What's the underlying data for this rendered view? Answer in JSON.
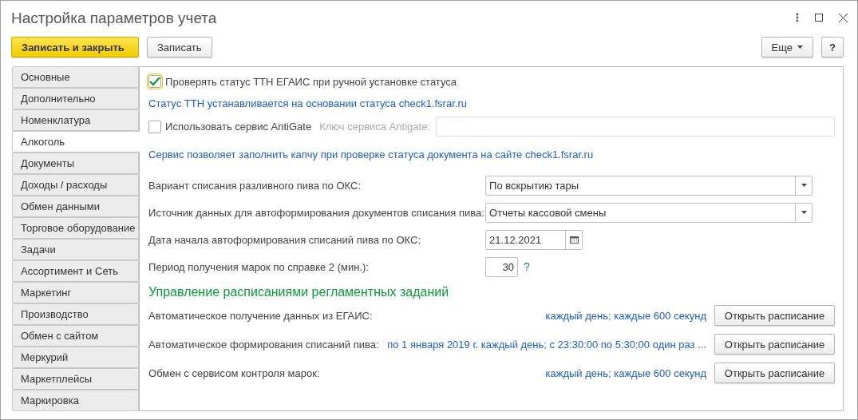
{
  "window": {
    "title": "Настройка параметров учета"
  },
  "toolbar": {
    "buttons": [
      {
        "label": "Записать и закрыть",
        "kind": "primary"
      },
      {
        "label": "Записать",
        "kind": "normal"
      }
    ],
    "more": "Еще",
    "help": "?"
  },
  "sidebar": {
    "items": [
      {
        "label": "Основные",
        "selected": false
      },
      {
        "label": "Дополнительно",
        "selected": false
      },
      {
        "label": "Номенклатура",
        "selected": false
      },
      {
        "label": "Алкоголь",
        "selected": true
      },
      {
        "label": "Документы",
        "selected": false
      },
      {
        "label": "Доходы / расходы",
        "selected": false
      },
      {
        "label": "Обмен данными",
        "selected": false
      },
      {
        "label": "Торговое оборудование",
        "selected": false
      },
      {
        "label": "Задачи",
        "selected": false
      },
      {
        "label": "Ассортимент и Сеть",
        "selected": false
      },
      {
        "label": "Маркетинг",
        "selected": false
      },
      {
        "label": "Производство",
        "selected": false
      },
      {
        "label": "Обмен с сайтом",
        "selected": false
      },
      {
        "label": "Меркурий",
        "selected": false
      },
      {
        "label": "Маркетплейсы",
        "selected": false
      },
      {
        "label": "Маркировка",
        "selected": false
      }
    ]
  },
  "content": {
    "check_status": {
      "label": "Проверять статус ТТН ЕГАИС при ручной установке статуса",
      "checked": true
    },
    "status_note": "Статус ТТН устанавливается на основании статуса check1.fsrar.ru",
    "antigate": {
      "label": "Использовать сервис AntiGate",
      "checked": false,
      "key_label": "Ключ сервиса Antigate:"
    },
    "antigate_note": "Сервис позволяет заполнить капчу при проверке статуса документа на сайте check1.fsrar.ru",
    "fields": [
      {
        "kind": "select",
        "label": "Вариант списания разливного пива по ОКС:",
        "value": "По вскрытию тары"
      },
      {
        "kind": "select",
        "label": "Источник данных для автоформирования документов списания пива:",
        "value": "Отчеты кассовой смены"
      },
      {
        "kind": "date",
        "label": "Дата начала автоформирования списаний пива по ОКС:",
        "value": "21.12.2021"
      },
      {
        "kind": "number",
        "label": "Период получения марок по справке 2 (мин.):",
        "value": "30",
        "help": "?"
      }
    ],
    "schedule_section": {
      "title": "Управление расписаниями регламентных заданий",
      "rows": [
        {
          "label": "Автоматическое получение данных из ЕГАИС:",
          "schedule": "каждый день; каждые 600 секунд",
          "button": "Открыть расписание"
        },
        {
          "label": "Автоматическое формирования списаний пива:",
          "schedule": "по 1 января 2019 г. каждый день; с 23:30:00 по 5:30:00 один раз ...",
          "button": "Открыть расписание"
        },
        {
          "label": "Обмен с сервисом контроля марок:",
          "schedule": "каждый день; каждые 600 секунд",
          "button": "Открыть расписание"
        }
      ]
    }
  }
}
